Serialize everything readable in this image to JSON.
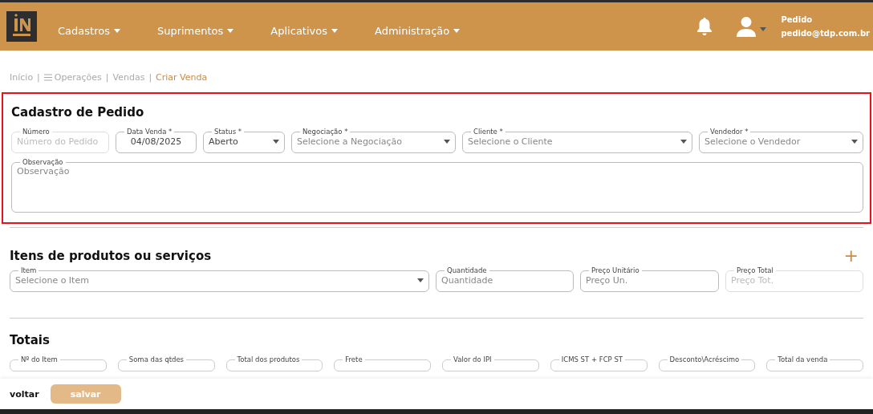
{
  "header": {
    "menus": [
      {
        "label": "Cadastros"
      },
      {
        "label": "Suprimentos"
      },
      {
        "label": "Aplicativos"
      },
      {
        "label": "Administração"
      }
    ],
    "user": {
      "name": "Pedido",
      "email": "pedido@tdp.com.br"
    }
  },
  "breadcrumb": {
    "separator": "|",
    "items": [
      {
        "label": "Início",
        "kind": "link",
        "current": false
      },
      {
        "label": "Operações",
        "kind": "menu",
        "current": false
      },
      {
        "label": "Vendas",
        "kind": "link",
        "current": false
      },
      {
        "label": "Criar Venda",
        "kind": "link",
        "current": true
      }
    ]
  },
  "order": {
    "title": "Cadastro de Pedido",
    "fields": [
      {
        "kind": "input",
        "label": "Número",
        "placeholder": "Número do Pedido",
        "disabled": true
      },
      {
        "kind": "date",
        "label": "Data Venda *",
        "value": "04/08/2025",
        "disabled": false
      },
      {
        "kind": "select",
        "label": "Status *",
        "value": "Aberto",
        "disabled": false
      },
      {
        "kind": "select",
        "label": "Negociação *",
        "placeholder": "Selecione a Negociação",
        "disabled": false
      },
      {
        "kind": "select",
        "label": "Cliente *",
        "placeholder": "Selecione o Cliente",
        "disabled": false
      },
      {
        "kind": "select",
        "label": "Vendedor *",
        "placeholder": "Selecione o Vendedor",
        "disabled": false
      }
    ],
    "note": {
      "label": "Observação",
      "placeholder": "Observação"
    }
  },
  "items": {
    "title": "Itens de produtos ou serviços",
    "add": "+",
    "fields": [
      {
        "kind": "select",
        "label": "Item",
        "placeholder": "Selecione o Item",
        "disabled": false
      },
      {
        "kind": "input",
        "label": "Quantidade",
        "placeholder": "Quantidade",
        "disabled": false
      },
      {
        "kind": "input",
        "label": "Preço Unitário",
        "placeholder": "Preço Un.",
        "disabled": false
      },
      {
        "kind": "input",
        "label": "Preço Total",
        "placeholder": "Preço Tot.",
        "disabled": true
      }
    ]
  },
  "totals": {
    "title": "Totais",
    "fields": [
      {
        "label": "Nº do Item"
      },
      {
        "label": "Soma das qtdes"
      },
      {
        "label": "Total dos produtos"
      },
      {
        "label": "Frete"
      },
      {
        "label": "Valor do IPI"
      },
      {
        "label": "ICMS ST + FCP ST"
      },
      {
        "label": "Desconto\\Acréscimo"
      },
      {
        "label": "Total da venda"
      }
    ]
  },
  "footer": {
    "back": "voltar",
    "save": {
      "label": "salvar",
      "disabled": true
    }
  }
}
